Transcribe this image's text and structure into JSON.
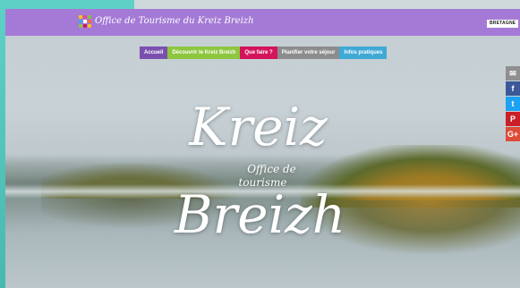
{
  "header": {
    "site_name": "Office de Tourisme du Kreiz Breizh",
    "region_logo": "BRETAGNE"
  },
  "nav": {
    "items": [
      {
        "label": "Accueil",
        "color": "#7b4fb0"
      },
      {
        "label": "Découvrir le Kreiz Breizh",
        "color": "#8dc63f"
      },
      {
        "label": "Que faire ?",
        "color": "#d4145a"
      },
      {
        "label": "Planifier votre séjour",
        "color": "#8c8c8c"
      },
      {
        "label": "Infos pratiques",
        "color": "#3fa9d6"
      }
    ]
  },
  "hero": {
    "line1": "Kreiz",
    "sub1": "Office de",
    "sub2": "tourisme",
    "line2": "Breizh"
  },
  "share": [
    {
      "icon": "email-icon",
      "glyph": "✉",
      "color": "#8f8f8f"
    },
    {
      "icon": "facebook-icon",
      "glyph": "f",
      "color": "#3b5998"
    },
    {
      "icon": "twitter-icon",
      "glyph": "t",
      "color": "#1da1f2"
    },
    {
      "icon": "pinterest-icon",
      "glyph": "P",
      "color": "#cb2027"
    },
    {
      "icon": "google-plus-icon",
      "glyph": "G+",
      "color": "#dd4b39"
    }
  ],
  "colors": {
    "header": "#a47ad6",
    "teal": "#5fd0c6"
  }
}
